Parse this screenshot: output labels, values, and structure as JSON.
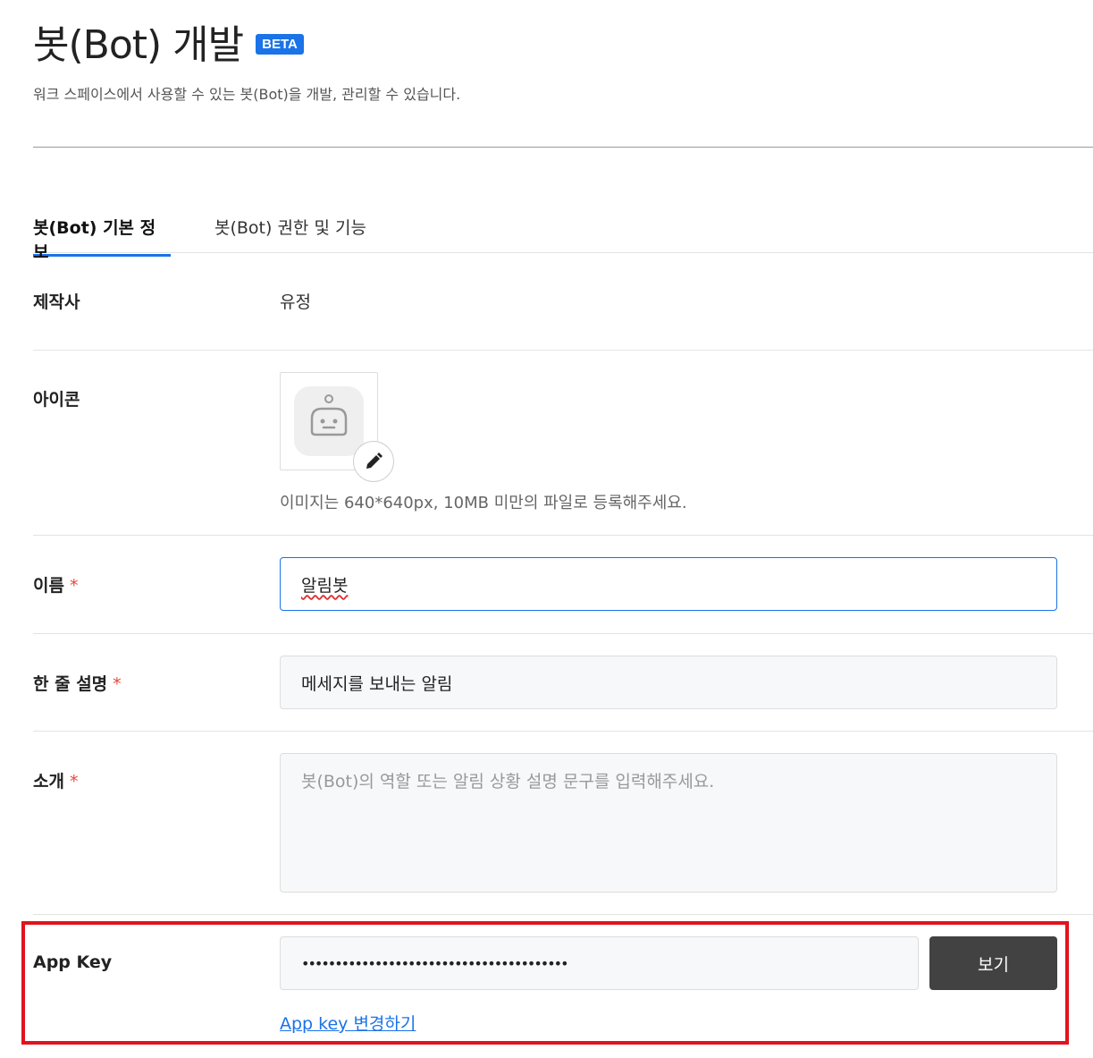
{
  "header": {
    "title": "봇(Bot) 개발",
    "badge": "BETA",
    "description": "워크 스페이스에서 사용할 수 있는 봇(Bot)을 개발, 관리할 수 있습니다."
  },
  "tabs": [
    {
      "label": "봇(Bot) 기본 정보",
      "active": true
    },
    {
      "label": "봇(Bot) 권한 및 기능",
      "active": false
    }
  ],
  "form": {
    "maker": {
      "label": "제작사",
      "value": "유정"
    },
    "icon": {
      "label": "아이콘",
      "hint": "이미지는 640*640px, 10MB 미만의 파일로 등록해주세요.",
      "edit_icon": "pencil-icon"
    },
    "name": {
      "label": "이름",
      "required": "*",
      "value": "알림봇"
    },
    "summary": {
      "label": "한 줄 설명",
      "required": "*",
      "value": "메세지를 보내는 알림"
    },
    "intro": {
      "label": "소개",
      "required": "*",
      "value": "",
      "placeholder": "봇(Bot)의 역할 또는 알림 상황 설명 문구를 입력해주세요."
    },
    "app_key": {
      "label": "App Key",
      "masked_value": "••••••••••••••••••••••••••••••••••••••••",
      "view_button": "보기",
      "change_link": "App key 변경하기"
    }
  },
  "colors": {
    "accent": "#1a73e8",
    "required": "#e5483b",
    "highlight": "#e0141e",
    "button_dark": "#424242"
  }
}
